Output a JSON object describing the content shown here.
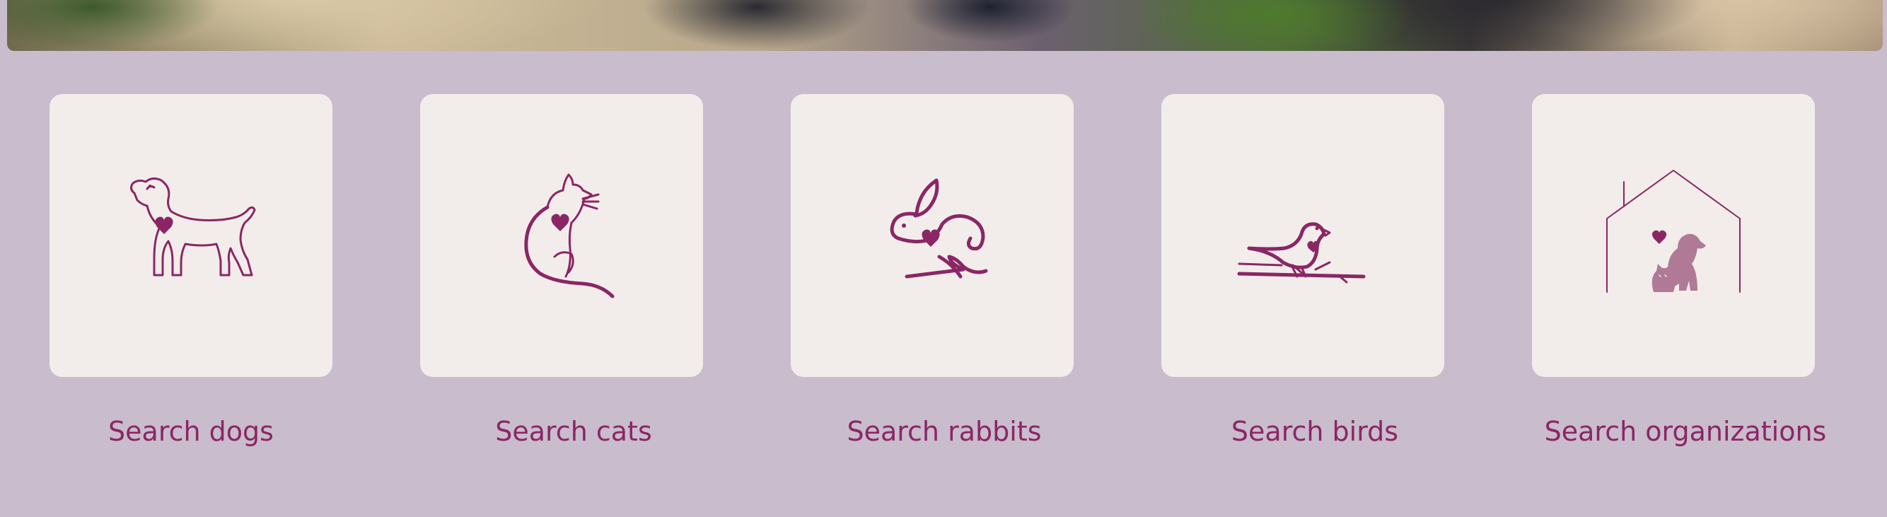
{
  "hero": {
    "image": "photo-of-pets-banner"
  },
  "colors": {
    "page_bg": "#c9bccc",
    "card_bg": "#f2edea",
    "accent": "#8b2665"
  },
  "categories": [
    {
      "label": "Search dogs",
      "icon": "dog-heart-icon"
    },
    {
      "label": "Search cats",
      "icon": "cat-heart-icon"
    },
    {
      "label": "Search rabbits",
      "icon": "rabbit-heart-icon"
    },
    {
      "label": "Search birds",
      "icon": "bird-heart-icon"
    },
    {
      "label": "Search organizations",
      "icon": "house-dog-cat-icon"
    }
  ]
}
